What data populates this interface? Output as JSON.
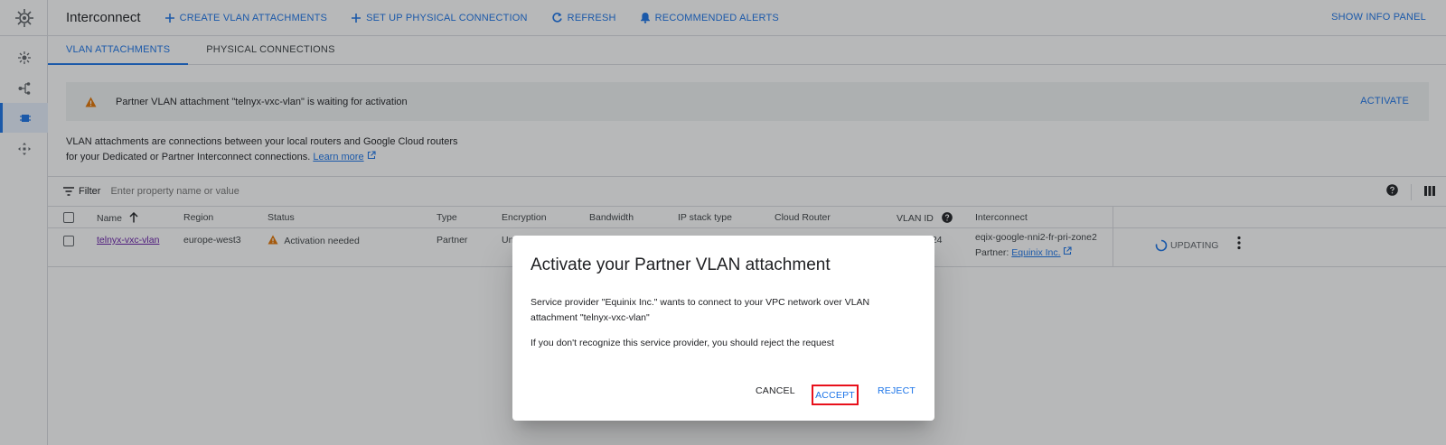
{
  "header": {
    "title": "Interconnect",
    "actions": [
      {
        "label": "CREATE VLAN ATTACHMENTS",
        "icon": "plus-icon"
      },
      {
        "label": "SET UP PHYSICAL CONNECTION",
        "icon": "plus-icon"
      },
      {
        "label": "REFRESH",
        "icon": "refresh-icon"
      },
      {
        "label": "RECOMMENDED ALERTS",
        "icon": "bell-icon"
      }
    ],
    "info_panel": "SHOW INFO PANEL"
  },
  "rail": {
    "items": [
      "interconnect-product-icon",
      "network-topology-icon",
      "attachment-icon",
      "routing-icon"
    ],
    "active_index": 2
  },
  "tabs": [
    {
      "label": "VLAN ATTACHMENTS",
      "active": true
    },
    {
      "label": "PHYSICAL CONNECTIONS",
      "active": false
    }
  ],
  "banner": {
    "message": "Partner VLAN attachment \"telnyx-vxc-vlan\" is waiting for activation",
    "action": "ACTIVATE"
  },
  "description": {
    "line1": "VLAN attachments are connections between your local routers and Google Cloud routers",
    "line2": "for your Dedicated or Partner Interconnect connections.",
    "link": "Learn more"
  },
  "filter": {
    "label": "Filter",
    "placeholder": "Enter property name or value"
  },
  "table": {
    "columns": [
      "Name",
      "Region",
      "Status",
      "Type",
      "Encryption",
      "Bandwidth",
      "IP stack type",
      "Cloud Router",
      "VLAN ID",
      "Interconnect"
    ],
    "row": {
      "name": "telnyx-vxc-vlan",
      "region": "europe-west3",
      "status": "Activation needed",
      "type": "Partner",
      "encryption": "Un",
      "vlan_id": "424",
      "interconnect": "eqix-google-nni2-fr-pri-zone2",
      "partner_label": "Partner:",
      "partner_link": "Equinix Inc.",
      "state": "UPDATING"
    }
  },
  "dialog": {
    "title": "Activate your Partner VLAN attachment",
    "body": "Service provider \"Equinix Inc.\" wants to connect to your VPC network over VLAN attachment \"telnyx-vxc-vlan\"",
    "warning": "If you don't recognize this service provider, you should reject the request",
    "cancel": "CANCEL",
    "accept": "ACCEPT",
    "reject": "REJECT"
  },
  "colors": {
    "accent": "#1a73e8",
    "warning": "#e37400",
    "highlight": "#e8101b"
  }
}
